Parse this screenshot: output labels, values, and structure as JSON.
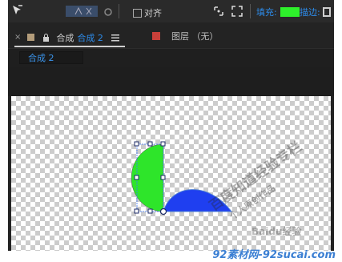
{
  "toolbar": {
    "align_label": "对齐",
    "fill_label": "填充:",
    "stroke_label": "描边:",
    "fill_color": "#2ef02b",
    "icons": [
      "selection-tool-icon",
      "rotate-tool-icon",
      "camera-tool-icon",
      "snap-icon",
      "expand-icon"
    ]
  },
  "tabs": {
    "comp_tab": {
      "close": "×",
      "label_prefix": "合成",
      "label_name": "合成 2",
      "swatch_color": "#b39c7a"
    },
    "layer_tab": {
      "label": "图层 （无）",
      "swatch_color": "#c8403a"
    },
    "comp_chip": "合成 2"
  },
  "canvas": {
    "shapes": [
      {
        "name": "green-half-circle",
        "color": "#2ee52a"
      },
      {
        "name": "blue-half-circle",
        "color": "#1f3ff0"
      }
    ]
  },
  "watermark": {
    "line1": "百度知道经验专栏",
    "line2": "个人原创作品",
    "baidu": "Baidu经验"
  },
  "footer": {
    "site": "92素材网-92sucai.com"
  }
}
